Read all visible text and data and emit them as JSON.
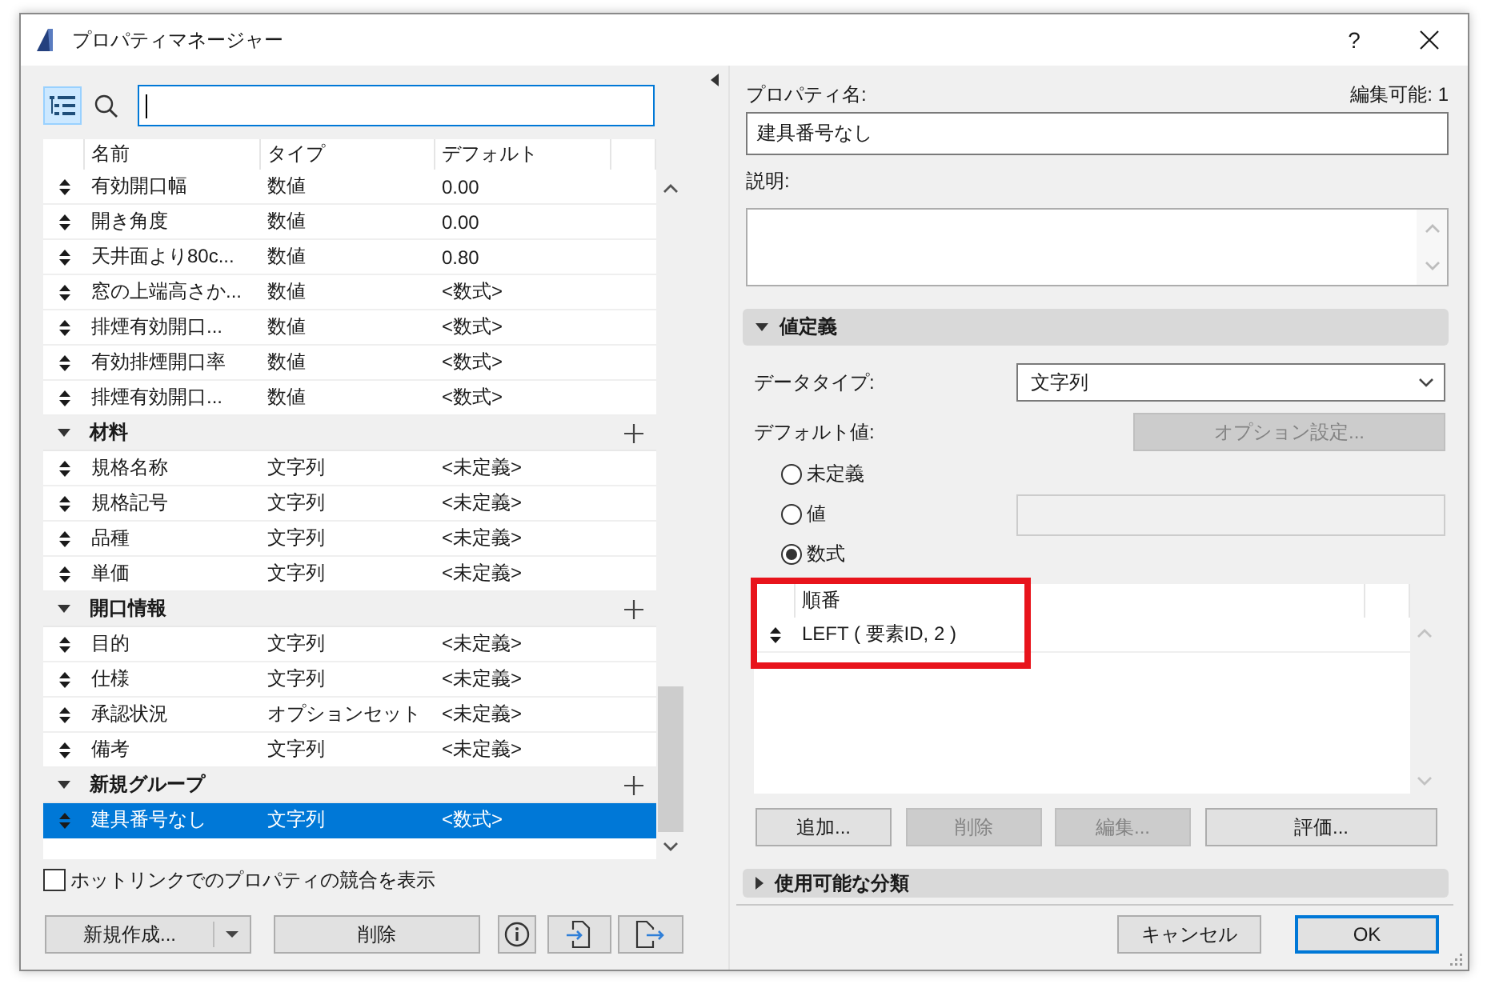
{
  "window": {
    "title": "プロパティマネージャー",
    "help_button": "?"
  },
  "left_panel": {
    "view_toggle": {
      "selected": true
    },
    "search": {
      "focused": true
    },
    "table": {
      "columns": [
        "名前",
        "タイプ",
        "デフォルト"
      ],
      "rows": [
        {
          "kind": "property",
          "name": "有効開口幅",
          "type": "数値",
          "default": "0.00",
          "selected": false
        },
        {
          "kind": "property",
          "name": "開き角度",
          "type": "数値",
          "default": "0.00",
          "selected": false
        },
        {
          "kind": "property",
          "name": "天井面より80c...",
          "type": "数値",
          "default": "0.80",
          "selected": false
        },
        {
          "kind": "property",
          "name": "窓の上端高さか...",
          "type": "数値",
          "default": "<数式>",
          "selected": false
        },
        {
          "kind": "property",
          "name": "排煙有効開口...",
          "type": "数値",
          "default": "<数式>",
          "selected": false
        },
        {
          "kind": "property",
          "name": "有効排煙開口率",
          "type": "数値",
          "default": "<数式>",
          "selected": false
        },
        {
          "kind": "property",
          "name": "排煙有効開口...",
          "type": "数値",
          "default": "<数式>",
          "selected": false
        },
        {
          "kind": "group",
          "name": "材料",
          "expanded": true,
          "selected": false,
          "children": [
            {
              "kind": "property",
              "name": "規格名称",
              "type": "文字列",
              "default": "<未定義>",
              "selected": false
            },
            {
              "kind": "property",
              "name": "規格記号",
              "type": "文字列",
              "default": "<未定義>",
              "selected": false
            },
            {
              "kind": "property",
              "name": "品種",
              "type": "文字列",
              "default": "<未定義>",
              "selected": false
            },
            {
              "kind": "property",
              "name": "単価",
              "type": "文字列",
              "default": "<未定義>",
              "selected": false
            }
          ]
        },
        {
          "kind": "group",
          "name": "開口情報",
          "expanded": true,
          "selected": false,
          "children": [
            {
              "kind": "property",
              "name": "目的",
              "type": "文字列",
              "default": "<未定義>",
              "selected": false
            },
            {
              "kind": "property",
              "name": "仕様",
              "type": "文字列",
              "default": "<未定義>",
              "selected": false
            },
            {
              "kind": "property",
              "name": "承認状況",
              "type": "オプションセット",
              "default": "<未定義>",
              "selected": false
            },
            {
              "kind": "property",
              "name": "備考",
              "type": "文字列",
              "default": "<未定義>",
              "selected": false
            }
          ]
        },
        {
          "kind": "group",
          "name": "新規グループ",
          "expanded": true,
          "selected": false,
          "children": [
            {
              "kind": "property",
              "name": "建具番号なし",
              "type": "文字列",
              "default": "<数式>",
              "selected": true
            }
          ]
        }
      ]
    },
    "hotlink_checkbox": {
      "label": "ホットリンクでのプロパティの競合を表示",
      "checked": false
    },
    "buttons": [
      {
        "kind": "split",
        "label": "新規作成..."
      },
      {
        "kind": "text",
        "label": "削除"
      },
      {
        "kind": "info"
      },
      {
        "kind": "import"
      },
      {
        "kind": "export"
      }
    ]
  },
  "right_panel": {
    "name_label": "プロパティ名:",
    "edit_status": "編集可能: 1",
    "name_value": "建具番号なし",
    "description_label": "説明:",
    "value_definition": {
      "title": "値定義",
      "expanded": true,
      "data_type_label": "データタイプ:",
      "data_type": "文字列",
      "default_label": "デフォルト値:",
      "options_button": {
        "label": "オプション設定...",
        "disabled": true
      },
      "default_options": [
        {
          "label": "未定義",
          "selected": false
        },
        {
          "label": "値",
          "selected": false,
          "field": {
            "disabled": true
          }
        },
        {
          "label": "数式",
          "selected": true
        }
      ],
      "formula_table": {
        "column": "順番",
        "highlighted": true,
        "rows": [
          {
            "formula": "LEFT ( 要素ID, 2 )",
            "selected": false
          }
        ]
      },
      "formula_buttons": [
        {
          "label": "追加...",
          "disabled": false
        },
        {
          "label": "削除",
          "disabled": true
        },
        {
          "label": "編集...",
          "disabled": true
        },
        {
          "label": "評価...",
          "disabled": false
        }
      ]
    },
    "classification": {
      "title": "使用可能な分類",
      "expanded": false
    }
  },
  "footer_buttons": [
    {
      "label": "キャンセル",
      "default": false
    },
    {
      "label": "OK",
      "default": true
    }
  ]
}
